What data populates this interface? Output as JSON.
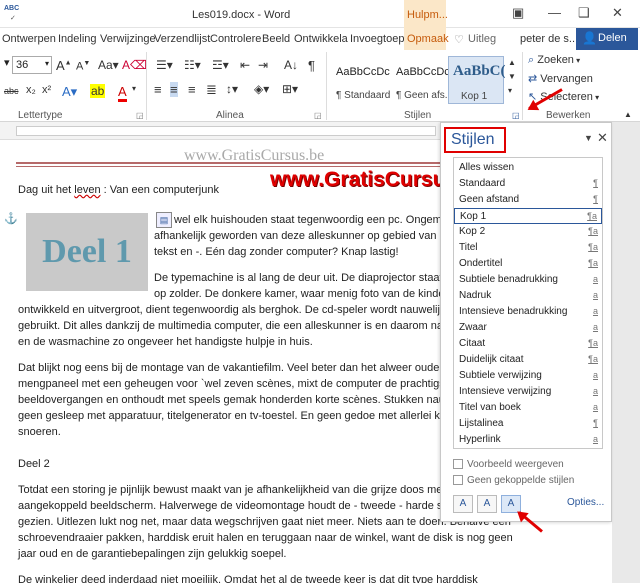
{
  "titlebar": {
    "qat_label": "ABC",
    "doc_title": "Les019.docx - Word",
    "contextual_tab": "Hulpm...",
    "minimize": "—",
    "restore": "❑",
    "close": "✕",
    "help": "?"
  },
  "tabs": [
    {
      "label": "Ontwerpen"
    },
    {
      "label": "Indeling"
    },
    {
      "label": "Verwijzinge"
    },
    {
      "label": "Verzendlijst"
    },
    {
      "label": "Controlere"
    },
    {
      "label": "Beeld"
    },
    {
      "label": "Ontwikkela"
    },
    {
      "label": "Invoegtoep"
    },
    {
      "label": "Opmaak"
    },
    {
      "label": "Uitleg"
    },
    {
      "label": "peter de s..."
    }
  ],
  "share_label": "Delen",
  "ribbon": {
    "font_size": "36",
    "groups": {
      "font": "Lettertype",
      "paragraph": "Alinea",
      "styles": "Stijlen",
      "editing": "Bewerken"
    },
    "style_tiles": [
      {
        "preview": "AaBbCcDc",
        "name": "¶ Standaard"
      },
      {
        "preview": "AaBbCcDc",
        "name": "¶ Geen afs..."
      },
      {
        "preview": "AaBbC(",
        "name": "Kop 1"
      }
    ],
    "editing": {
      "find": "Zoeken",
      "replace": "Vervangen",
      "select": "Selecteren"
    },
    "format_buttons": {
      "sub": "abc",
      "sup": "x²",
      "x2": "x₂"
    }
  },
  "doc": {
    "watermark_gray": "www.GratisCursus.be",
    "watermark_red": "www.GratisCursus.be",
    "image_text": "Deel 1",
    "title_prefix": "Dag uit het ",
    "title_leven": "leven",
    "title_suffix": " : Van een computerjunk",
    "lines": [
      "wel elk huishouden staat tegenwoordig een pc. Ongem",
      "afhankelijk geworden van deze alleskunner op gebied van m",
      "tekst en -. Eén dag zonder computer? Knap lastig!",
      "De typemachine is al lang de deur uit. De diaprojector staat",
      "op zolder. De donkere kamer, waar menig foto van de kinde",
      "ontwikkeld en uitvergroot, dient tegenwoordig als berghok. De cd-speler wordt nauwelij",
      "gebruikt. Dit alles dankzij de multimedia computer, die een alleskunner is en daarom na c",
      "en de wasmachine zo ongeveer het handigste hulpje in huis.",
      "Dat blijkt nog eens bij de montage van de vakantiefilm. Veel beter dan het alweer ouderv",
      "mengpaneel met een geheugen voor `wel zeven scènes, mixt de computer de prachtigste",
      "beeldovergangen en onthoudt met speels gemak honderden korte scènes. Stukken nauw",
      "geen gesleep met apparatuur, titelgenerator en tv-toestel. En geen gedoe met allerlei ka",
      "snoeren.",
      "Deel 2",
      "Totdat een storing je pijnlijk bewust maakt van je afhankelijkheid van die grijze doos met",
      "aangekoppeld beeldscherm. Halverwege de videomontage houdt de - tweede - harde sch",
      "gezien. Uitlezen lukt nog net, maar data wegschrijven gaat niet meer. Niets aan te doen. Behalve een",
      "schroevendraaier pakken, harddisk eruit halen en teruggaan naar de winkel, want de disk is nog geen",
      "jaar oud en de garantiebepalingen zijn gelukkig soepel.",
      "De winkelier deed inderdaad niet moeilijk. Omdat het al de tweede keer is dat dit type harddisk"
    ]
  },
  "pane": {
    "title": "Stijlen",
    "styles": [
      {
        "name": "Alles wissen",
        "mark": ""
      },
      {
        "name": "Standaard",
        "mark": "¶"
      },
      {
        "name": "Geen afstand",
        "mark": "¶"
      },
      {
        "name": "Kop 1",
        "mark": "¶a"
      },
      {
        "name": "Kop 2",
        "mark": "¶a"
      },
      {
        "name": "Titel",
        "mark": "¶a"
      },
      {
        "name": "Ondertitel",
        "mark": "¶a"
      },
      {
        "name": "Subtiele benadrukking",
        "mark": "a"
      },
      {
        "name": "Nadruk",
        "mark": "a"
      },
      {
        "name": "Intensieve benadrukking",
        "mark": "a"
      },
      {
        "name": "Zwaar",
        "mark": "a"
      },
      {
        "name": "Citaat",
        "mark": "¶a"
      },
      {
        "name": "Duidelijk citaat",
        "mark": "¶a"
      },
      {
        "name": "Subtiele verwijzing",
        "mark": "a"
      },
      {
        "name": "Intensieve verwijzing",
        "mark": "a"
      },
      {
        "name": "Titel van boek",
        "mark": "a"
      },
      {
        "name": "Lijstalinea",
        "mark": "¶"
      },
      {
        "name": "Hyperlink",
        "mark": "a"
      }
    ],
    "show_preview": "Voorbeeld weergeven",
    "disable_linked": "Geen gekoppelde stijlen",
    "options": "Opties...",
    "new_style": "A",
    "style_inspector": "A",
    "manage_styles": "A"
  }
}
